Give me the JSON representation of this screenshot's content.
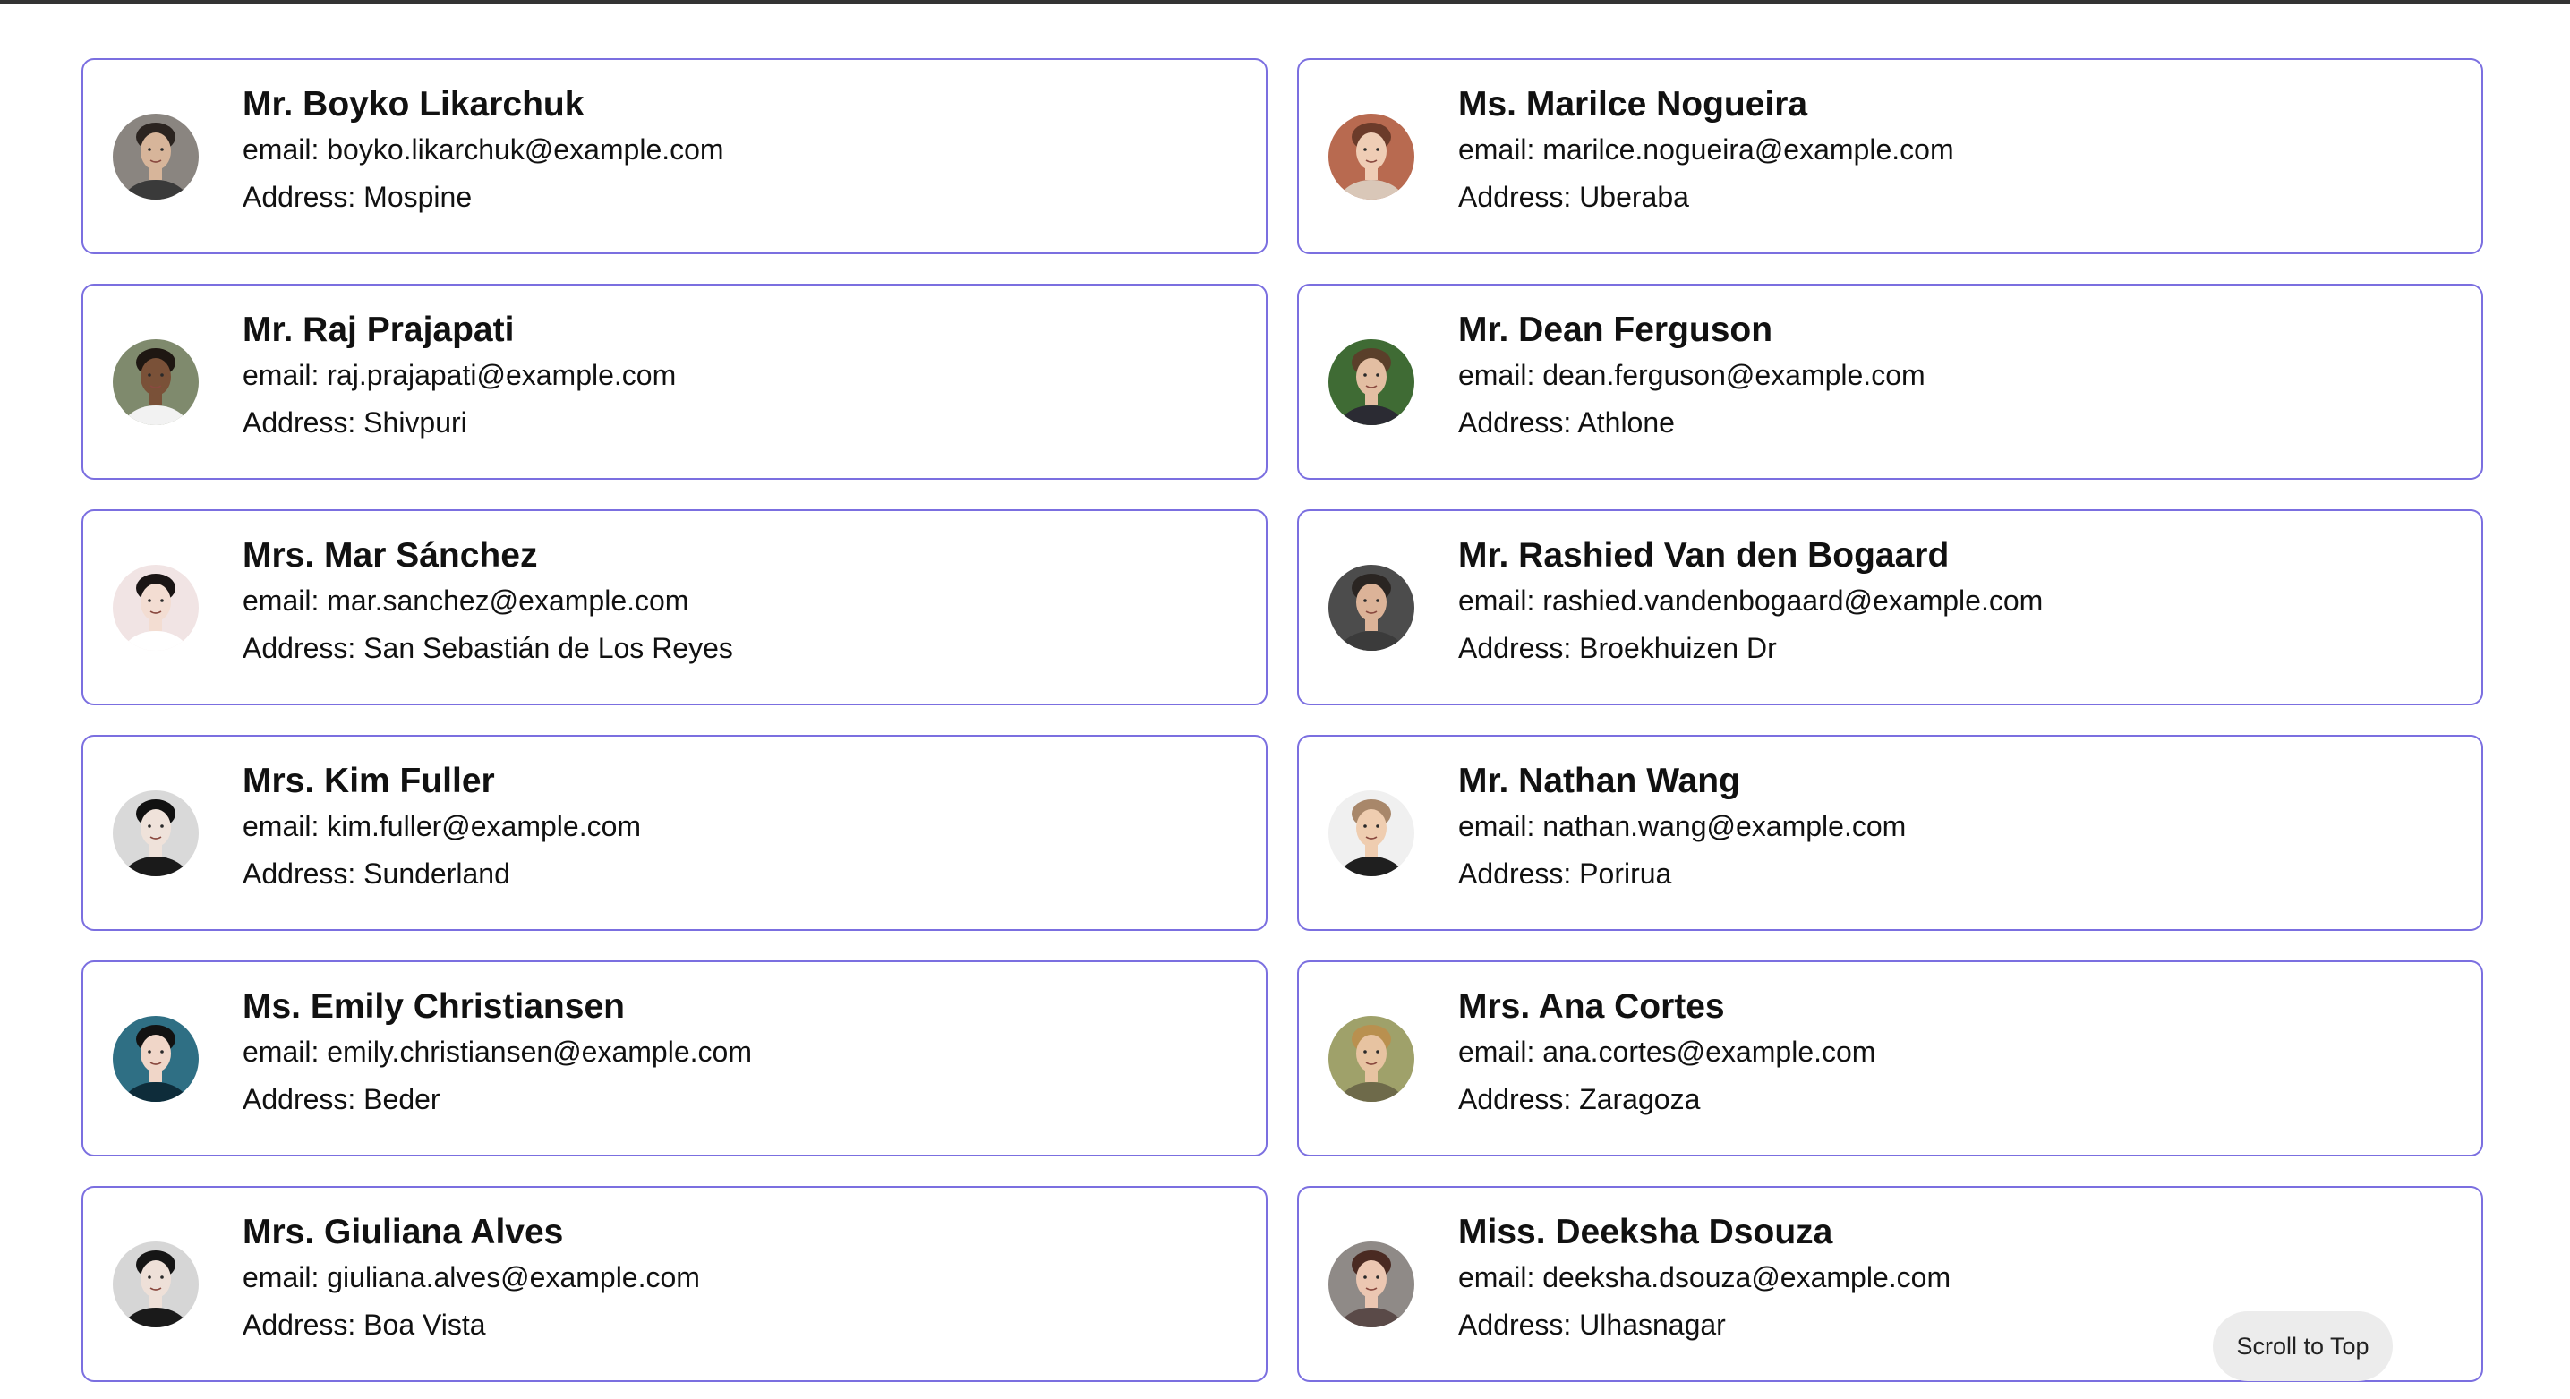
{
  "users": [
    {
      "name": "Mr. Boyko Likarchuk",
      "email": "email: boyko.likarchuk@example.com",
      "address": "Address: Mospine",
      "bg": "#8a8580",
      "skin": "#d7b59a",
      "hair": "#2b2420",
      "shirt": "#3a3a3a"
    },
    {
      "name": "Ms. Marilce Nogueira",
      "email": "email: marilce.nogueira@example.com",
      "address": "Address: Uberaba",
      "bg": "#b86a50",
      "skin": "#efcdb5",
      "hair": "#6b3b2a",
      "shirt": "#d9c7b8"
    },
    {
      "name": "Mr. Raj Prajapati",
      "email": "email: raj.prajapati@example.com",
      "address": "Address: Shivpuri",
      "bg": "#7f8a6d",
      "skin": "#7a5138",
      "hair": "#1e1712",
      "shirt": "#f2f2f2"
    },
    {
      "name": "Mr. Dean Ferguson",
      "email": "email: dean.ferguson@example.com",
      "address": "Address: Athlone",
      "bg": "#3f6b34",
      "skin": "#e3bea2",
      "hair": "#5a3f2a",
      "shirt": "#2b2b33"
    },
    {
      "name": "Mrs. Mar Sánchez",
      "email": "email: mar.sanchez@example.com",
      "address": "Address: San Sebastián de Los Reyes",
      "bg": "#f1e4e4",
      "skin": "#f3ddd2",
      "hair": "#1a1515",
      "shirt": "#ffffff"
    },
    {
      "name": "Mr. Rashied Van den Bogaard",
      "email": "email: rashied.vandenbogaard@example.com",
      "address": "Address: Broekhuizen Dr",
      "bg": "#4c4c4c",
      "skin": "#dcb398",
      "hair": "#2a2522",
      "shirt": "#3b3b3b"
    },
    {
      "name": "Mrs. Kim Fuller",
      "email": "email: kim.fuller@example.com",
      "address": "Address: Sunderland",
      "bg": "#d9d9d9",
      "skin": "#efe2da",
      "hair": "#111111",
      "shirt": "#1a1a1a"
    },
    {
      "name": "Mr. Nathan Wang",
      "email": "email: nathan.wang@example.com",
      "address": "Address: Porirua",
      "bg": "#f0f0f0",
      "skin": "#efcdb0",
      "hair": "#a8876a",
      "shirt": "#1f1f1f"
    },
    {
      "name": "Ms. Emily Christiansen",
      "email": "email: emily.christiansen@example.com",
      "address": "Address: Beder",
      "bg": "#2f6f84",
      "skin": "#f0d6c8",
      "hair": "#121212",
      "shirt": "#0e2c3a"
    },
    {
      "name": "Mrs. Ana Cortes",
      "email": "email: ana.cortes@example.com",
      "address": "Address: Zaragoza",
      "bg": "#9fa16a",
      "skin": "#e7c3a1",
      "hair": "#b9904f",
      "shirt": "#6e6a4a"
    },
    {
      "name": "Mrs. Giuliana Alves",
      "email": "email: giuliana.alves@example.com",
      "address": "Address: Boa Vista",
      "bg": "#d6d6d6",
      "skin": "#eee0d8",
      "hair": "#151515",
      "shirt": "#1a1a1a"
    },
    {
      "name": "Miss. Deeksha Dsouza",
      "email": "email: deeksha.dsouza@example.com",
      "address": "Address: Ulhasnagar",
      "bg": "#8f8a87",
      "skin": "#ecc7b2",
      "hair": "#4a2a22",
      "shirt": "#5a4a48"
    }
  ],
  "scroll_button": "Scroll to Top"
}
